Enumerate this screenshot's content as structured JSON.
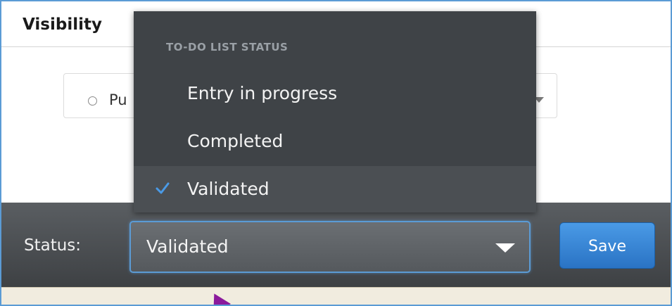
{
  "section": {
    "title": "Visibility"
  },
  "visibility": {
    "value": "Pu"
  },
  "dropdown": {
    "header": "TO-DO LIST STATUS",
    "items": [
      {
        "label": "Entry in progress",
        "selected": false
      },
      {
        "label": "Completed",
        "selected": false
      },
      {
        "label": "Validated",
        "selected": true
      }
    ]
  },
  "status_bar": {
    "label": "Status:",
    "value": "Validated",
    "save_label": "Save"
  },
  "icons": {
    "check": "check-icon",
    "caret": "chevron-down-icon",
    "pointer": "pointer-arrow-icon"
  },
  "colors": {
    "accent": "#5b9bd5",
    "save_button": "#2a73c4",
    "menu_background": "#3f4347",
    "check": "#4a9ae6",
    "pointer_arrow": "#8b1a9c"
  }
}
